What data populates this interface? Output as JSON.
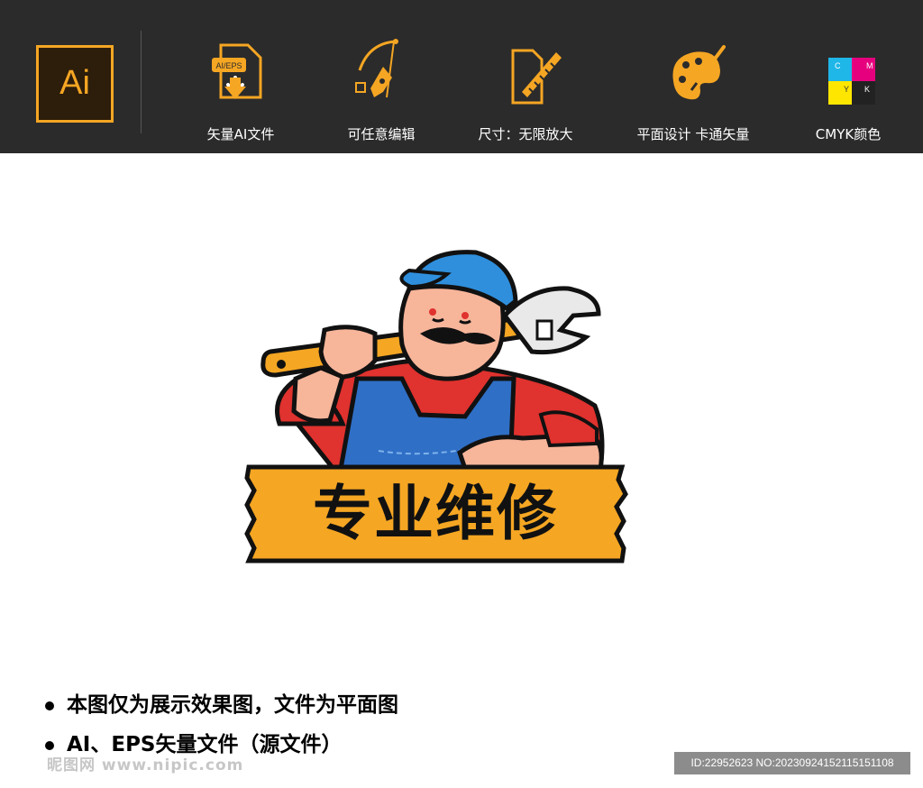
{
  "topbar": {
    "app_logo_text": "Ai",
    "features": [
      {
        "label": "矢量AI文件",
        "icon": "file-download-icon",
        "badge": "AI/EPS"
      },
      {
        "label": "可任意编辑",
        "icon": "pen-tool-icon"
      },
      {
        "label": "尺寸：无限放大",
        "icon": "ruler-icon"
      },
      {
        "label": "平面设计  卡通矢量",
        "icon": "palette-icon"
      },
      {
        "label": "CMYK颜色",
        "icon": "cmyk-puzzle-icon",
        "letters": [
          "C",
          "M",
          "Y",
          "K"
        ]
      }
    ],
    "accent_color": "#f5a623"
  },
  "logo": {
    "banner_text": "专业维修",
    "colors": {
      "banner": "#f5a623",
      "cap": "#2f8fdc",
      "overalls": "#2f6fc6",
      "shirt": "#e0322e",
      "skin": "#f7b59a"
    }
  },
  "notes": [
    "本图仅为展示效果图，文件为平面图",
    "AI、EPS矢量文件（源文件）"
  ],
  "watermark": "昵图网 www.nipic.com",
  "image_id": "ID:22952623 NO:20230924152115151108"
}
